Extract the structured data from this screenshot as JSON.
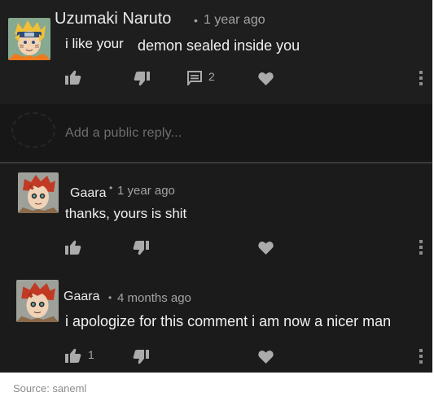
{
  "comments": [
    {
      "author": "Uzumaki Naruto",
      "separator": "•",
      "timestamp": "1 year ago",
      "text_part1": "i like your",
      "text_part2": "demon sealed inside you",
      "reply_count": "2",
      "avatar_icon": "naruto-avatar"
    },
    {
      "author": "Gaara",
      "separator": "•",
      "timestamp": "1 year ago",
      "text": "thanks, yours is shit",
      "avatar_icon": "gaara-avatar"
    },
    {
      "author": "Gaara",
      "separator": "•",
      "timestamp": "4 months ago",
      "text": "i apologize for this comment i am now a nicer man",
      "like_count": "1",
      "avatar_icon": "gaara-avatar"
    }
  ],
  "reply_box": {
    "placeholder": "Add a public reply..."
  },
  "icons": [
    "thumbs-up-icon",
    "thumbs-down-icon",
    "reply-icon",
    "heart-icon",
    "more-vert-icon"
  ],
  "colors": {
    "background": "#1b1b1b",
    "text": "#f0f0f0",
    "meta": "#a3a3a3",
    "icon": "#a8a8a8"
  },
  "source": "Source: saneml"
}
